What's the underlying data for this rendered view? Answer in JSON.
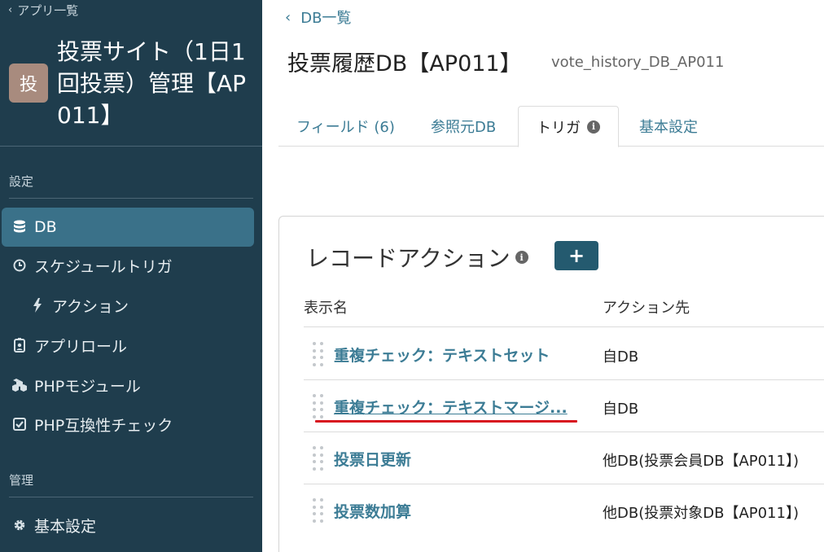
{
  "sidebar": {
    "back_label": "アプリ一覧",
    "app_avatar_char": "投",
    "app_title": "投票サイト（1日1回投票）管理【AP011】",
    "section_settings": "設定",
    "section_admin": "管理",
    "items": [
      {
        "label": "DB",
        "icon": "database-icon",
        "active": true
      },
      {
        "label": "スケジュールトリガ",
        "icon": "clock-icon"
      },
      {
        "label": "アクション",
        "icon": "bolt-icon"
      },
      {
        "label": "アプリロール",
        "icon": "badge-icon"
      },
      {
        "label": "PHPモジュール",
        "icon": "cubes-icon"
      },
      {
        "label": "PHP互換性チェック",
        "icon": "check-square-icon"
      },
      {
        "label": "基本設定",
        "icon": "gear-icon"
      }
    ]
  },
  "main": {
    "breadcrumb": "DB一覧",
    "title": "投票履歴DB【AP011】",
    "subtitle": "vote_history_DB_AP011",
    "tabs": [
      {
        "label": "フィールド (6)"
      },
      {
        "label": "参照元DB"
      },
      {
        "label": "トリガ",
        "active": true
      },
      {
        "label": "基本設定"
      }
    ],
    "panel": {
      "title": "レコードアクション",
      "add_button": "+",
      "col_name": "表示名",
      "col_target": "アクション先",
      "rows": [
        {
          "name": "重複チェック：テキストセット",
          "target": "自DB"
        },
        {
          "name": "重複チェック：テキストマージ...",
          "target": "自DB"
        },
        {
          "name": "投票日更新",
          "target": "他DB(投票会員DB【AP011】)"
        },
        {
          "name": "投票数加算",
          "target": "他DB(投票対象DB【AP011】)"
        }
      ]
    }
  },
  "colors": {
    "sidebar_bg": "#1f3d4d",
    "active_item": "#3a7189",
    "link": "#3c7c95",
    "button": "#245a6f",
    "annotation_red": "#d8141f"
  }
}
